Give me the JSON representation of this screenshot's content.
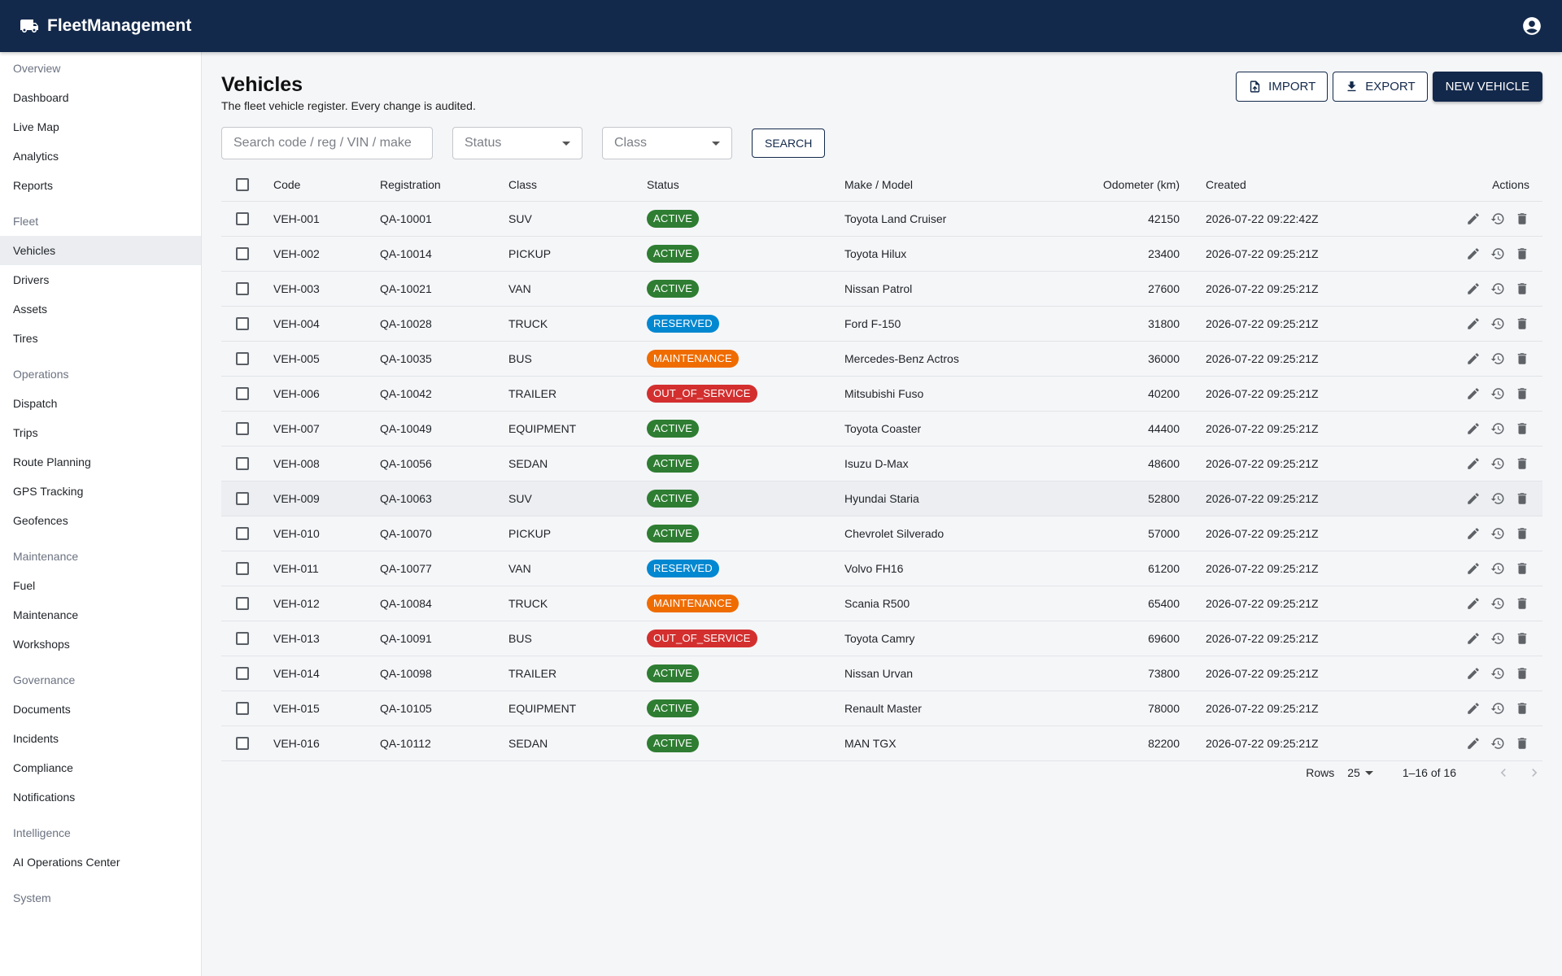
{
  "app": {
    "title": "FleetManagement"
  },
  "sidebar": {
    "sections": [
      {
        "label": "Overview",
        "items": [
          "Dashboard",
          "Live Map",
          "Analytics",
          "Reports"
        ]
      },
      {
        "label": "Fleet",
        "items": [
          "Vehicles",
          "Drivers",
          "Assets",
          "Tires"
        ]
      },
      {
        "label": "Operations",
        "items": [
          "Dispatch",
          "Trips",
          "Route Planning",
          "GPS Tracking",
          "Geofences"
        ]
      },
      {
        "label": "Maintenance",
        "items": [
          "Fuel",
          "Maintenance",
          "Workshops"
        ]
      },
      {
        "label": "Governance",
        "items": [
          "Documents",
          "Incidents",
          "Compliance",
          "Notifications"
        ]
      },
      {
        "label": "Intelligence",
        "items": [
          "AI Operations Center"
        ]
      },
      {
        "label": "System",
        "items": []
      }
    ],
    "active": "Vehicles"
  },
  "page": {
    "title": "Vehicles",
    "subtitle": "The fleet vehicle register. Every change is audited."
  },
  "toolbar": {
    "import_label": "IMPORT",
    "export_label": "EXPORT",
    "new_label": "NEW VEHICLE"
  },
  "filters": {
    "search_placeholder": "Search code / reg / VIN / make",
    "status_placeholder": "Status",
    "class_placeholder": "Class",
    "search_button": "SEARCH"
  },
  "table": {
    "columns": {
      "code": "Code",
      "registration": "Registration",
      "class": "Class",
      "status": "Status",
      "make_model": "Make / Model",
      "odometer": "Odometer (km)",
      "created": "Created",
      "actions": "Actions"
    },
    "rows": [
      {
        "code": "VEH-001",
        "registration": "QA-10001",
        "class": "SUV",
        "status": "ACTIVE",
        "make_model": "Toyota Land Cruiser",
        "odometer": "42150",
        "created": "2026-07-22 09:22:42Z"
      },
      {
        "code": "VEH-002",
        "registration": "QA-10014",
        "class": "PICKUP",
        "status": "ACTIVE",
        "make_model": "Toyota Hilux",
        "odometer": "23400",
        "created": "2026-07-22 09:25:21Z"
      },
      {
        "code": "VEH-003",
        "registration": "QA-10021",
        "class": "VAN",
        "status": "ACTIVE",
        "make_model": "Nissan Patrol",
        "odometer": "27600",
        "created": "2026-07-22 09:25:21Z"
      },
      {
        "code": "VEH-004",
        "registration": "QA-10028",
        "class": "TRUCK",
        "status": "RESERVED",
        "make_model": "Ford F-150",
        "odometer": "31800",
        "created": "2026-07-22 09:25:21Z"
      },
      {
        "code": "VEH-005",
        "registration": "QA-10035",
        "class": "BUS",
        "status": "MAINTENANCE",
        "make_model": "Mercedes-Benz Actros",
        "odometer": "36000",
        "created": "2026-07-22 09:25:21Z"
      },
      {
        "code": "VEH-006",
        "registration": "QA-10042",
        "class": "TRAILER",
        "status": "OUT_OF_SERVICE",
        "make_model": "Mitsubishi Fuso",
        "odometer": "40200",
        "created": "2026-07-22 09:25:21Z"
      },
      {
        "code": "VEH-007",
        "registration": "QA-10049",
        "class": "EQUIPMENT",
        "status": "ACTIVE",
        "make_model": "Toyota Coaster",
        "odometer": "44400",
        "created": "2026-07-22 09:25:21Z"
      },
      {
        "code": "VEH-008",
        "registration": "QA-10056",
        "class": "SEDAN",
        "status": "ACTIVE",
        "make_model": "Isuzu D-Max",
        "odometer": "48600",
        "created": "2026-07-22 09:25:21Z"
      },
      {
        "code": "VEH-009",
        "registration": "QA-10063",
        "class": "SUV",
        "status": "ACTIVE",
        "make_model": "Hyundai Staria",
        "odometer": "52800",
        "created": "2026-07-22 09:25:21Z"
      },
      {
        "code": "VEH-010",
        "registration": "QA-10070",
        "class": "PICKUP",
        "status": "ACTIVE",
        "make_model": "Chevrolet Silverado",
        "odometer": "57000",
        "created": "2026-07-22 09:25:21Z"
      },
      {
        "code": "VEH-011",
        "registration": "QA-10077",
        "class": "VAN",
        "status": "RESERVED",
        "make_model": "Volvo FH16",
        "odometer": "61200",
        "created": "2026-07-22 09:25:21Z"
      },
      {
        "code": "VEH-012",
        "registration": "QA-10084",
        "class": "TRUCK",
        "status": "MAINTENANCE",
        "make_model": "Scania R500",
        "odometer": "65400",
        "created": "2026-07-22 09:25:21Z"
      },
      {
        "code": "VEH-013",
        "registration": "QA-10091",
        "class": "BUS",
        "status": "OUT_OF_SERVICE",
        "make_model": "Toyota Camry",
        "odometer": "69600",
        "created": "2026-07-22 09:25:21Z"
      },
      {
        "code": "VEH-014",
        "registration": "QA-10098",
        "class": "TRAILER",
        "status": "ACTIVE",
        "make_model": "Nissan Urvan",
        "odometer": "73800",
        "created": "2026-07-22 09:25:21Z"
      },
      {
        "code": "VEH-015",
        "registration": "QA-10105",
        "class": "EQUIPMENT",
        "status": "ACTIVE",
        "make_model": "Renault Master",
        "odometer": "78000",
        "created": "2026-07-22 09:25:21Z"
      },
      {
        "code": "VEH-016",
        "registration": "QA-10112",
        "class": "SEDAN",
        "status": "ACTIVE",
        "make_model": "MAN TGX",
        "odometer": "82200",
        "created": "2026-07-22 09:25:21Z"
      }
    ],
    "hovered_row": "VEH-009"
  },
  "pagination": {
    "rows_label": "Rows",
    "rows_per_page": "25",
    "range": "1–16 of 16"
  },
  "colors": {
    "topbar": "#13294b",
    "active": "#2e7d32",
    "reserved": "#0288d1",
    "maintenance": "#ef6c00",
    "out_of_service": "#d32f2f"
  },
  "icons": {
    "brand": "truck-icon",
    "account": "account-circle-icon",
    "import": "file-upload-icon",
    "export": "download-icon",
    "row_actions": [
      "edit-icon",
      "history-icon",
      "delete-icon"
    ],
    "pager": [
      "chevron-left-icon",
      "chevron-right-icon"
    ]
  }
}
